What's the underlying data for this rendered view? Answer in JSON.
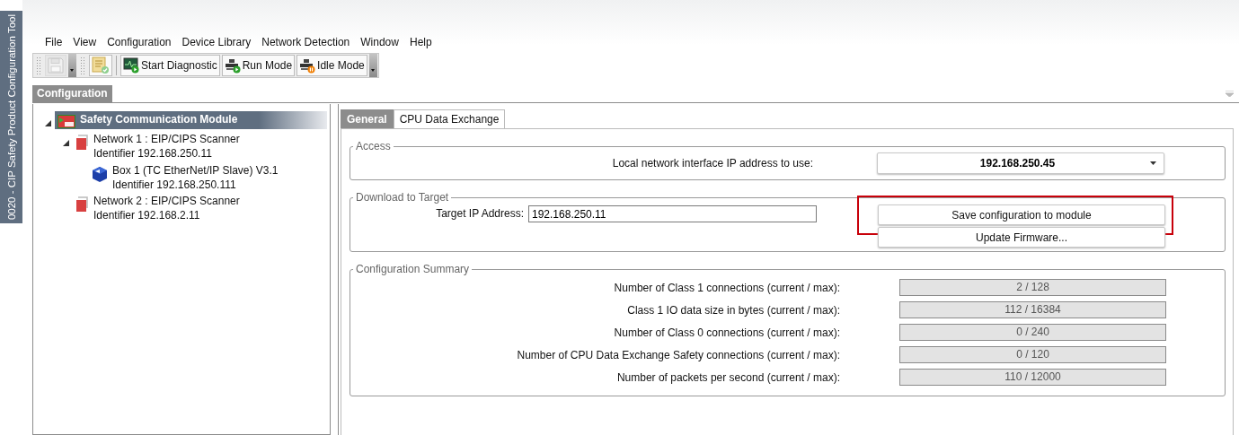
{
  "side_title": "0020 - CIP Safety Product Configuration Tool",
  "menu": [
    "File",
    "View",
    "Configuration",
    "Device Library",
    "Network Detection",
    "Window",
    "Help"
  ],
  "toolbar": [
    {
      "kind": "save",
      "disabled": true
    },
    {
      "kind": "check",
      "disabled": false
    },
    {
      "kind": "diagnostic",
      "label": "Start Diagnostic",
      "disabled": false
    },
    {
      "kind": "run",
      "label": "Run Mode",
      "disabled": false
    },
    {
      "kind": "idle",
      "label": "Idle Mode",
      "disabled": false
    }
  ],
  "panel_tab": "Configuration",
  "tree": [
    {
      "label": "Safety Communication Module",
      "kind": "module",
      "selected": true,
      "expanded": true,
      "children": [
        {
          "label": "Network 1 : EIP/CIPS Scanner",
          "detail": "Identifier 192.168.250.11",
          "kind": "network",
          "selected": false,
          "expanded": true,
          "children": [
            {
              "label": "Box 1 (TC EtherNet/IP Slave) V3.1",
              "detail": "Identifier 192.168.250.111",
              "kind": "device",
              "selected": false
            }
          ]
        },
        {
          "label": "Network 2 : EIP/CIPS Scanner",
          "detail": "Identifier 192.168.2.11",
          "kind": "network",
          "selected": false
        }
      ]
    }
  ],
  "tabs": [
    {
      "label": "General",
      "selected": true
    },
    {
      "label": "CPU Data Exchange",
      "selected": false
    }
  ],
  "access": {
    "title": "Access",
    "label": "Local network interface IP address to use:",
    "value": "192.168.250.45"
  },
  "download": {
    "title": "Download to Target",
    "label": "Target IP Address:",
    "value": "192.168.250.11",
    "buttons": [
      {
        "label": "Save configuration to module",
        "highlighted": true
      },
      {
        "label": "Update Firmware...",
        "highlighted": false
      }
    ]
  },
  "summary": {
    "title": "Configuration Summary",
    "rows": [
      {
        "label": "Number of Class 1 connections (current / max):",
        "value": "2 / 128"
      },
      {
        "label": "Class 1 IO data size in bytes (current / max):",
        "value": "112 / 16384"
      },
      {
        "label": "Number of Class 0 connections (current / max):",
        "value": "0 / 240"
      },
      {
        "label": "Number of CPU Data Exchange Safety connections (current / max):",
        "value": "0 / 120"
      },
      {
        "label": "Number of packets per second (current / max):",
        "value": "110 / 12000"
      }
    ]
  }
}
